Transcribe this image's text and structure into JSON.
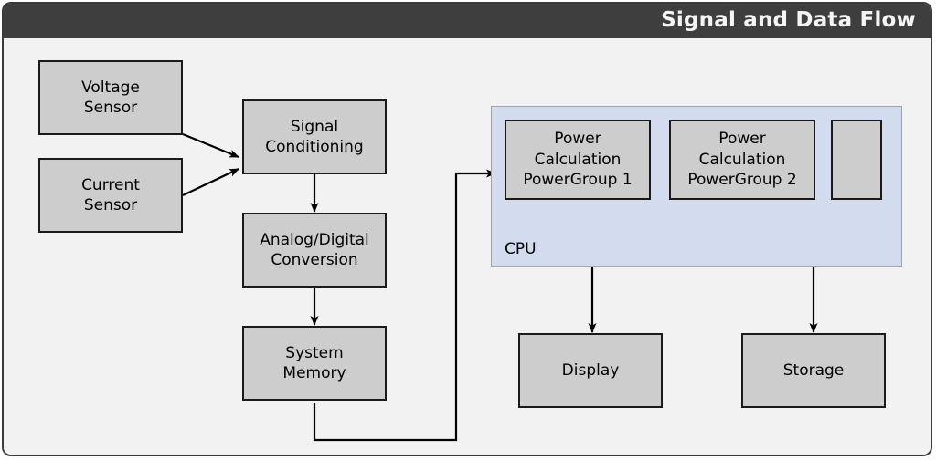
{
  "window": {
    "title": "Signal and Data Flow",
    "title_bar_color": "#3e3e3e",
    "title_text_color": "#f5f5f5",
    "canvas_color": "#f2f2f2",
    "frame_border_color": "#3b3b3b"
  },
  "palette": {
    "node_fill": "#cdcdcd",
    "node_border": "#1a1a1a",
    "group_fill": "#d2dcee",
    "group_border": "#9aa3b0",
    "connector": "#000000"
  },
  "nodes": {
    "voltage_sensor": {
      "label": "Voltage\nSensor"
    },
    "current_sensor": {
      "label": "Current\nSensor"
    },
    "signal_conditioning": {
      "label": "Signal\nConditioning"
    },
    "analog_digital_conversion": {
      "label": "Analog/Digital\nConversion"
    },
    "system_memory": {
      "label": "System\nMemory"
    },
    "display": {
      "label": "Display"
    },
    "storage": {
      "label": "Storage"
    }
  },
  "cpu_group": {
    "label": "CPU",
    "children": [
      {
        "label": "Power\nCalculation\nPowerGroup 1"
      },
      {
        "label": "Power\nCalculation\nPowerGroup 2"
      },
      {
        "label": ""
      }
    ]
  },
  "connections": [
    {
      "from": "voltage_sensor",
      "to": "signal_conditioning",
      "arrow": true
    },
    {
      "from": "current_sensor",
      "to": "signal_conditioning",
      "arrow": true
    },
    {
      "from": "signal_conditioning",
      "to": "analog_digital_conversion",
      "arrow": true
    },
    {
      "from": "analog_digital_conversion",
      "to": "system_memory",
      "arrow": true
    },
    {
      "from": "system_memory",
      "to": "cpu_powergroup_1",
      "arrow": true
    },
    {
      "from": "cpu_group",
      "to": "display",
      "arrow": true
    },
    {
      "from": "cpu_group",
      "to": "storage",
      "arrow": true
    }
  ]
}
